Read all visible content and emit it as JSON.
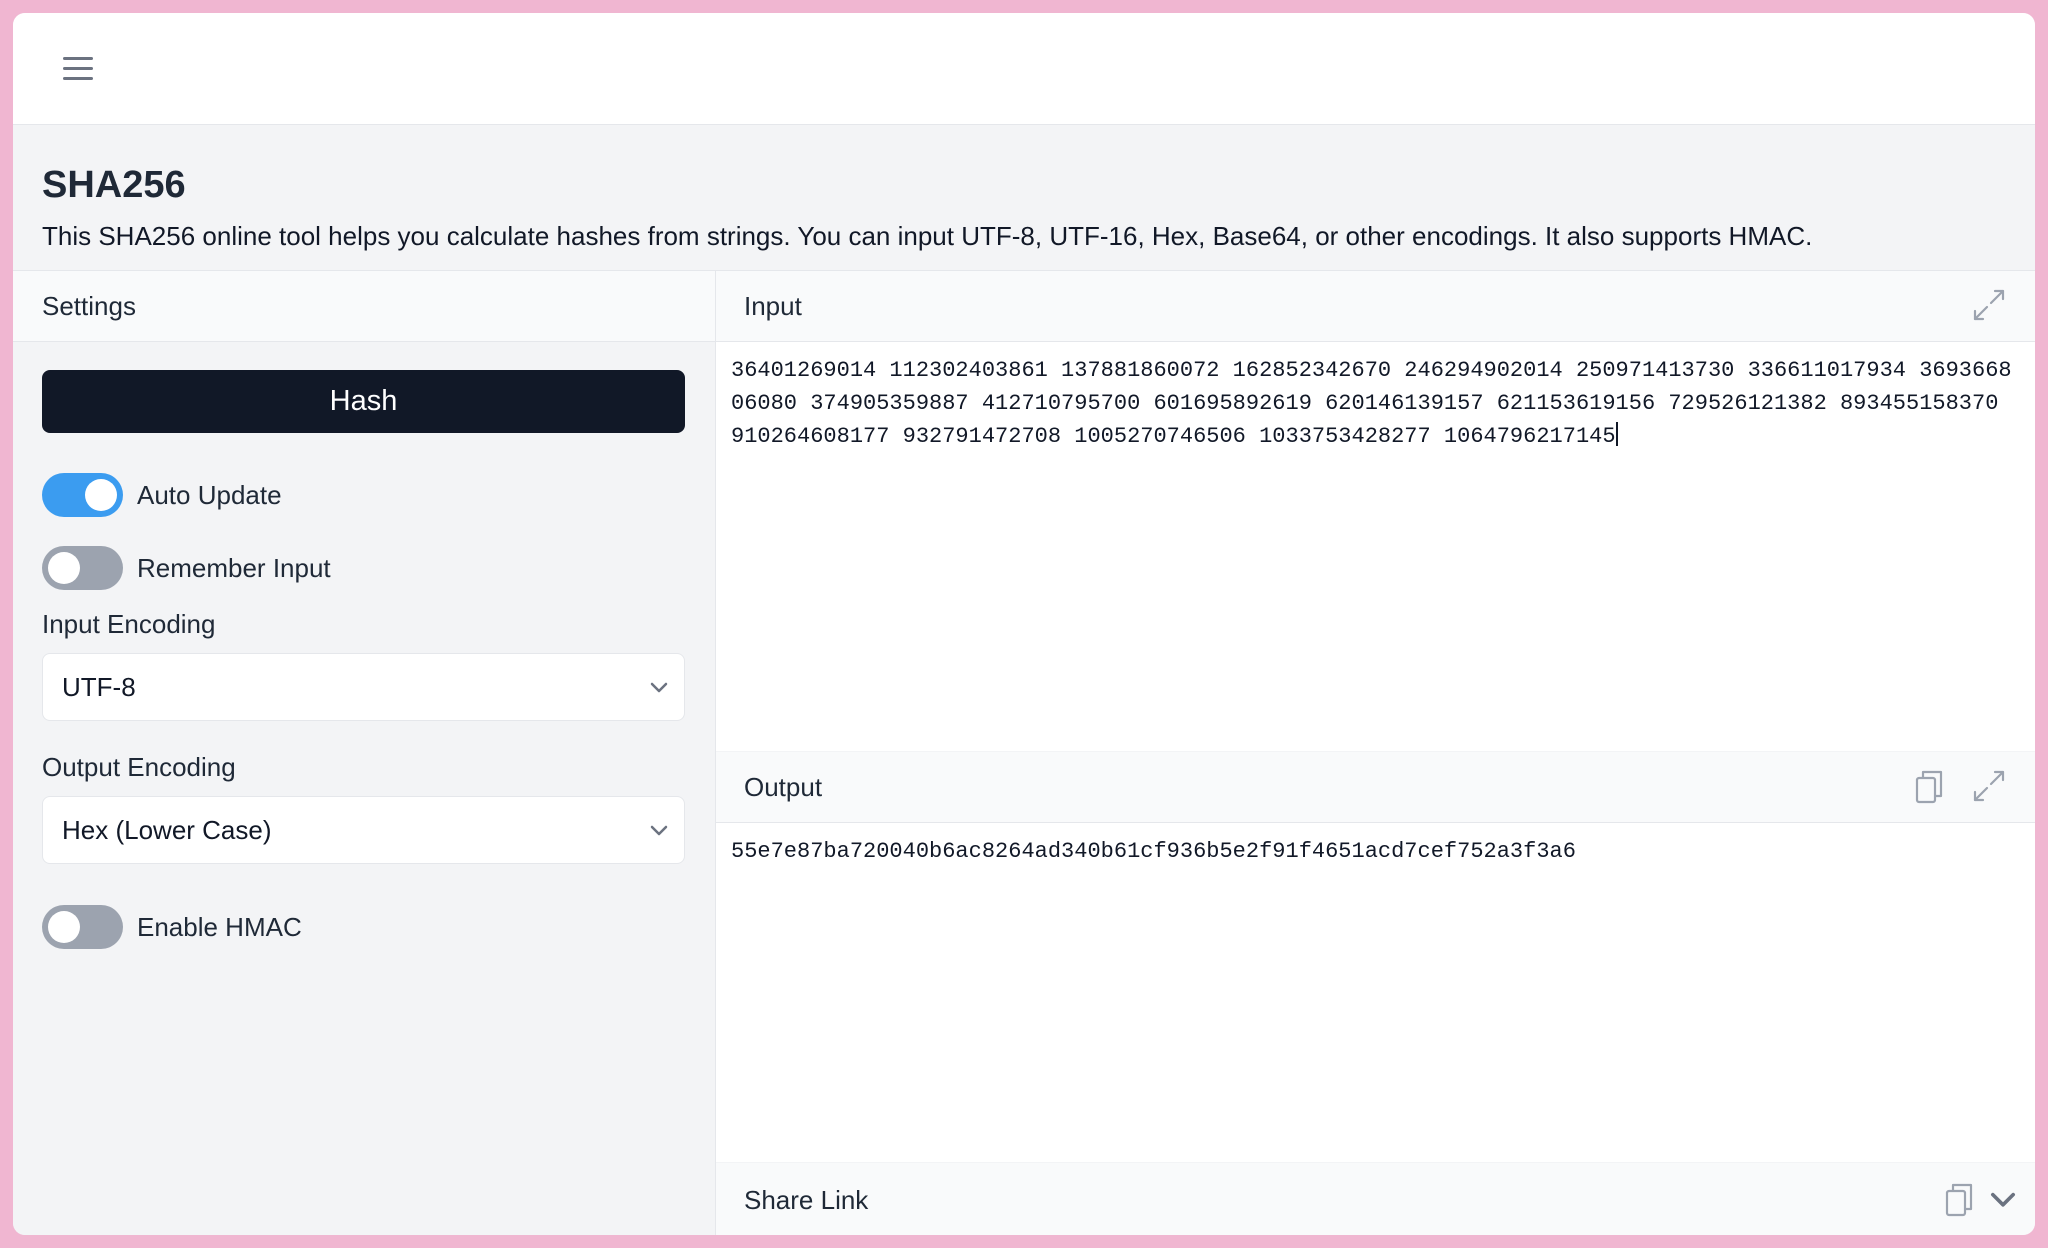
{
  "header": {
    "menu_icon": "hamburger-menu-icon"
  },
  "page": {
    "title": "SHA256",
    "description": "This SHA256 online tool helps you calculate hashes from strings. You can input UTF-8, UTF-16, Hex, Base64, or other encodings. It also supports HMAC."
  },
  "settings": {
    "heading": "Settings",
    "hash_button": "Hash",
    "auto_update": {
      "label": "Auto Update",
      "on": true
    },
    "remember_input": {
      "label": "Remember Input",
      "on": false
    },
    "input_encoding": {
      "label": "Input Encoding",
      "value": "UTF-8"
    },
    "output_encoding": {
      "label": "Output Encoding",
      "value": "Hex (Lower Case)"
    },
    "enable_hmac": {
      "label": "Enable HMAC",
      "on": false
    }
  },
  "input": {
    "heading": "Input",
    "value": "36401269014 112302403861 137881860072 162852342670 246294902014 250971413730 336611017934 369366806080 374905359887 412710795700 601695892619 620146139157 621153619156 729526121382 893455158370 910264608177 932791472708 1005270746506 1033753428277 1064796217145",
    "expand_icon": "expand-icon"
  },
  "output": {
    "heading": "Output",
    "value": "55e7e87ba720040b6ac8264ad340b61cf936b5e2f91f4651acd7cef752a3f3a6",
    "copy_icon": "copy-icon",
    "expand_icon": "expand-icon"
  },
  "share_link": {
    "heading": "Share Link",
    "copy_icon": "copy-icon",
    "chevron_icon": "chevron-down-icon"
  },
  "colors": {
    "toggle_on": "#3b9cf0",
    "toggle_off": "#9ca3af",
    "primary_button": "#111827",
    "frame": "#f0b6d1"
  }
}
